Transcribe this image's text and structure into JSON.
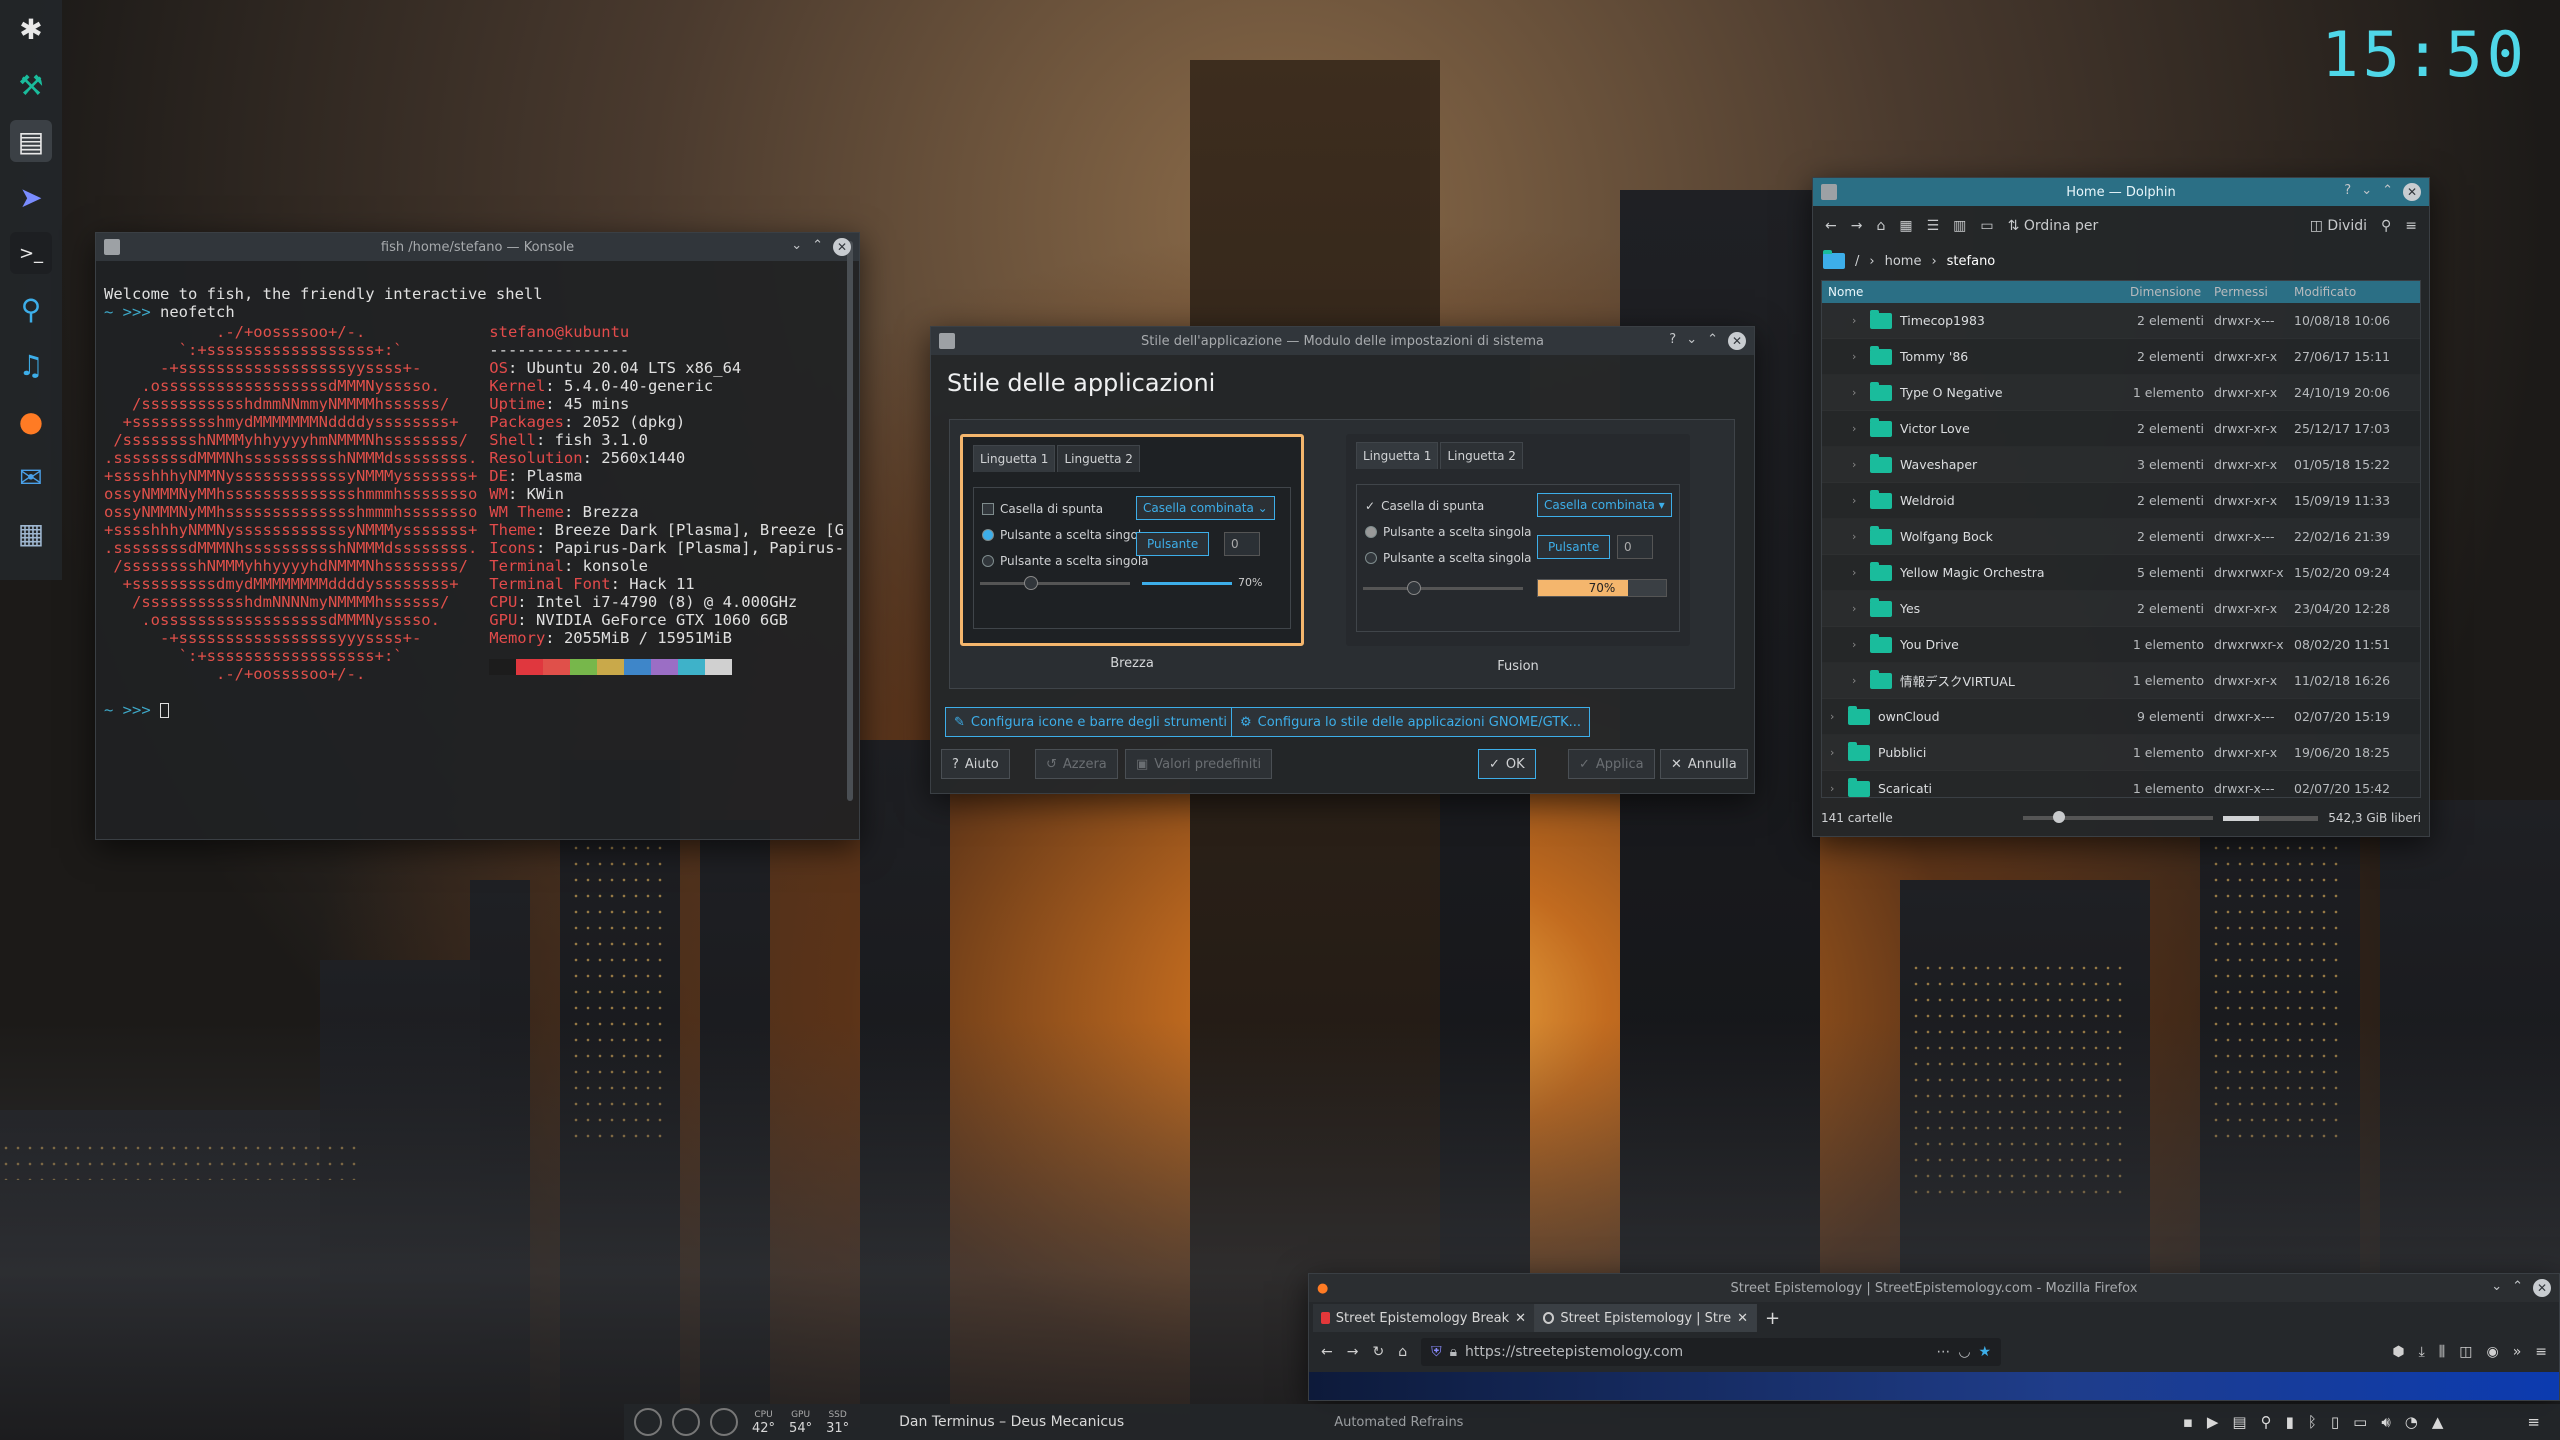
{
  "desktop": {
    "clock": "15:50"
  },
  "panel": {
    "icons": [
      "kde-icon",
      "tool-icon",
      "files-icon",
      "pointer-icon",
      "terminal-icon",
      "link-icon",
      "music-icon",
      "firefox-icon",
      "mail-icon",
      "settings-icon"
    ]
  },
  "konsole": {
    "title": "fish /home/stefano — Konsole",
    "welcome": "Welcome to fish, the friendly interactive shell",
    "prompt": "~ >>> ",
    "command": "neofetch",
    "logo": [
      "            .-/+oossssoo+/-.",
      "        `:+ssssssssssssssssss+:`",
      "      -+ssssssssssssssssssyyssss+-",
      "    .ossssssssssssssssssdMMMNysssso.",
      "   /ssssssssssshdmmNNmmyNMMMMhssssss/",
      "  +ssssssssshmydMMMMMMMNddddyssssssss+",
      " /sssssssshNMMMyhhyyyyhmNMMMNhssssssss/",
      ".ssssssssdMMMNhsssssssssshNMMMdssssssss.",
      "+sssshhhyNMMNyssssssssssssyNMMMysssssss+",
      "ossyNMMMNyMMhsssssssssssssshmmmhssssssso",
      "ossyNMMMNyMMhsssssssssssssshmmmhssssssso",
      "+sssshhhyNMMNyssssssssssssyNMMMysssssss+",
      ".ssssssssdMMMNhsssssssssshNMMMdssssssss.",
      " /sssssssshNMMMyhhyyyyhdNMMMNhssssssss/",
      "  +sssssssssdmydMMMMMMMMddddyssssssss+",
      "   /ssssssssssshdmNNNNmyNMMMMhssssss/",
      "    .ossssssssssssssssssdMMMNysssso.",
      "      -+sssssssssssssssssyyyssss+-",
      "        `:+ssssssssssssssssss+:`",
      "            .-/+oossssoo+/-."
    ],
    "userhost": "stefano@kubuntu",
    "rule": "---------------",
    "info": [
      {
        "k": "OS",
        "v": "Ubuntu 20.04 LTS x86_64"
      },
      {
        "k": "Kernel",
        "v": "5.4.0-40-generic"
      },
      {
        "k": "Uptime",
        "v": "45 mins"
      },
      {
        "k": "Packages",
        "v": "2052 (dpkg)"
      },
      {
        "k": "Shell",
        "v": "fish 3.1.0"
      },
      {
        "k": "Resolution",
        "v": "2560x1440"
      },
      {
        "k": "DE",
        "v": "Plasma"
      },
      {
        "k": "WM",
        "v": "KWin"
      },
      {
        "k": "WM Theme",
        "v": "Brezza"
      },
      {
        "k": "Theme",
        "v": "Breeze Dark [Plasma], Breeze [G"
      },
      {
        "k": "Icons",
        "v": "Papirus-Dark [Plasma], Papirus-"
      },
      {
        "k": "Terminal",
        "v": "konsole"
      },
      {
        "k": "Terminal Font",
        "v": "Hack 11"
      },
      {
        "k": "CPU",
        "v": "Intel i7-4790 (8) @ 4.000GHz"
      },
      {
        "k": "GPU",
        "v": "NVIDIA GeForce GTX 1060 6GB"
      },
      {
        "k": "Memory",
        "v": "2055MiB / 15951MiB"
      }
    ],
    "palette": [
      "#1c1c1c",
      "#e0373e",
      "#e0504a",
      "#77b74b",
      "#c9a94a",
      "#3e86c9",
      "#9b6ec5",
      "#3eb2c9",
      "#d0d0d0"
    ],
    "prompt2": "~ >>> "
  },
  "settings": {
    "title": "Stile dell'applicazione — Modulo delle impostazioni di sistema",
    "heading": "Stile delle applicazioni",
    "previews": [
      {
        "name": "Brezza",
        "tab1": "Linguetta 1",
        "tab2": "Linguetta 2",
        "check": "Casella di spunta",
        "radio1": "Pulsante a scelta singola",
        "radio2": "Pulsante a scelta singola",
        "combo": "Casella combinata",
        "button": "Pulsante",
        "spin": "0",
        "progress": "70%"
      },
      {
        "name": "Fusion",
        "tab1": "Linguetta 1",
        "tab2": "Linguetta 2",
        "check": "Casella di spunta",
        "radio1": "Pulsante a scelta singola",
        "radio2": "Pulsante a scelta singola",
        "combo": "Casella combinata",
        "button": "Pulsante",
        "spin": "0",
        "progress": "70%"
      }
    ],
    "progress_fraction": 0.7,
    "cfg_icons": "Configura icone e barre degli strumenti",
    "cfg_gtk": "Configura lo stile delle applicazioni GNOME/GTK...",
    "help": "Aiuto",
    "reset": "Azzera",
    "defaults": "Valori predefiniti",
    "ok": "OK",
    "apply": "Applica",
    "cancel": "Annulla"
  },
  "dolphin": {
    "title": "Home — Dolphin",
    "sort": "Ordina per",
    "split": "Dividi",
    "path": [
      "/",
      "home",
      "stefano"
    ],
    "columns": {
      "name": "Nome",
      "size": "Dimensione",
      "perm": "Permessi",
      "mod": "Modificato"
    },
    "rows": [
      {
        "name": "Timecop1983",
        "size": "2 elementi",
        "perm": "drwxr-x---",
        "mod": "10/08/18 10:06",
        "sub": true
      },
      {
        "name": "Tommy '86",
        "size": "2 elementi",
        "perm": "drwxr-xr-x",
        "mod": "27/06/17 15:11",
        "sub": true
      },
      {
        "name": "Type O Negative",
        "size": "1 elemento",
        "perm": "drwxr-xr-x",
        "mod": "24/10/19 20:06",
        "sub": true
      },
      {
        "name": "Victor Love",
        "size": "2 elementi",
        "perm": "drwxr-xr-x",
        "mod": "25/12/17 17:03",
        "sub": true
      },
      {
        "name": "Waveshaper",
        "size": "3 elementi",
        "perm": "drwxr-xr-x",
        "mod": "01/05/18 15:22",
        "sub": true
      },
      {
        "name": "Weldroid",
        "size": "2 elementi",
        "perm": "drwxr-xr-x",
        "mod": "15/09/19 11:33",
        "sub": true
      },
      {
        "name": "Wolfgang Bock",
        "size": "2 elementi",
        "perm": "drwxr-x---",
        "mod": "22/02/16 21:39",
        "sub": true
      },
      {
        "name": "Yellow Magic Orchestra",
        "size": "5 elementi",
        "perm": "drwxrwxr-x",
        "mod": "15/02/20 09:24",
        "sub": true
      },
      {
        "name": "Yes",
        "size": "2 elementi",
        "perm": "drwxr-xr-x",
        "mod": "23/04/20 12:28",
        "sub": true
      },
      {
        "name": "You Drive",
        "size": "1 elemento",
        "perm": "drwxrwxr-x",
        "mod": "08/02/20 11:51",
        "sub": true
      },
      {
        "name": "情報デスクVIRTUAL",
        "size": "1 elemento",
        "perm": "drwxr-xr-x",
        "mod": "11/02/18 16:26",
        "sub": true
      },
      {
        "name": "ownCloud",
        "size": "9 elementi",
        "perm": "drwxr-x---",
        "mod": "02/07/20 15:19",
        "sub": false
      },
      {
        "name": "Pubblici",
        "size": "1 elemento",
        "perm": "drwxr-xr-x",
        "mod": "19/06/20 18:25",
        "sub": false
      },
      {
        "name": "Scaricati",
        "size": "1 elemento",
        "perm": "drwxr-x---",
        "mod": "02/07/20 15:42",
        "sub": false
      }
    ],
    "status_left": "141 cartelle",
    "status_right": "542,3 GiB liberi",
    "disk_used_fraction": 0.38
  },
  "firefox": {
    "title": "Street Epistemology | StreetEpistemology.com - Mozilla Firefox",
    "tab1": "Street Epistemology Break",
    "tab2": "Street Epistemology | Stre",
    "url": "https://streetepistemology.com"
  },
  "taskbar": {
    "cpu_label": "CPU",
    "cpu_val": "42°",
    "gpu_label": "GPU",
    "gpu_val": "54°",
    "ssd_label": "SSD",
    "ssd_val": "31°",
    "now_playing": "Dan Terminus – Deus Mecanicus",
    "window_title": "Automated Refrains"
  }
}
